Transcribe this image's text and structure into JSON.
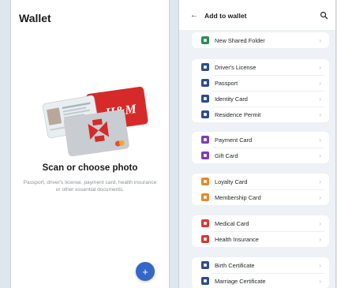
{
  "left": {
    "title": "Wallet",
    "scan_title": "Scan or choose photo",
    "scan_desc": "Passport, driver's license, payment card, health insurance or other essential documents.",
    "card_logo": "H&M",
    "fab_icon": "+"
  },
  "right": {
    "title": "Add to wallet",
    "back_icon": "←",
    "groups": [
      {
        "items": [
          {
            "label": "New Shared Folder",
            "icon": "folder-icon",
            "color": "#2e8b57"
          }
        ]
      },
      {
        "items": [
          {
            "label": "Driver's License",
            "icon": "car-icon",
            "color": "#2f4d8a"
          },
          {
            "label": "Passport",
            "icon": "passport-icon",
            "color": "#2f4d8a"
          },
          {
            "label": "Identity Card",
            "icon": "id-card-icon",
            "color": "#2f4d8a"
          },
          {
            "label": "Residence Permit",
            "icon": "residence-permit-icon",
            "color": "#2f4d8a"
          }
        ]
      },
      {
        "items": [
          {
            "label": "Payment Card",
            "icon": "credit-card-icon",
            "color": "#7b3fb8"
          },
          {
            "label": "Gift Card",
            "icon": "gift-icon",
            "color": "#7b3fb8"
          }
        ]
      },
      {
        "items": [
          {
            "label": "Loyalty Card",
            "icon": "loyalty-card-icon",
            "color": "#e6892a"
          },
          {
            "label": "Membership Card",
            "icon": "membership-card-icon",
            "color": "#e6892a"
          }
        ]
      },
      {
        "items": [
          {
            "label": "Medical Card",
            "icon": "medical-card-icon",
            "color": "#d23a3a"
          },
          {
            "label": "Health Insurance",
            "icon": "shield-icon",
            "color": "#d23a3a"
          }
        ]
      },
      {
        "items": [
          {
            "label": "Birth Certificate",
            "icon": "birth-certificate-icon",
            "color": "#2f4d8a"
          },
          {
            "label": "Marriage Certificate",
            "icon": "marriage-certificate-icon",
            "color": "#2f4d8a"
          }
        ]
      }
    ]
  }
}
